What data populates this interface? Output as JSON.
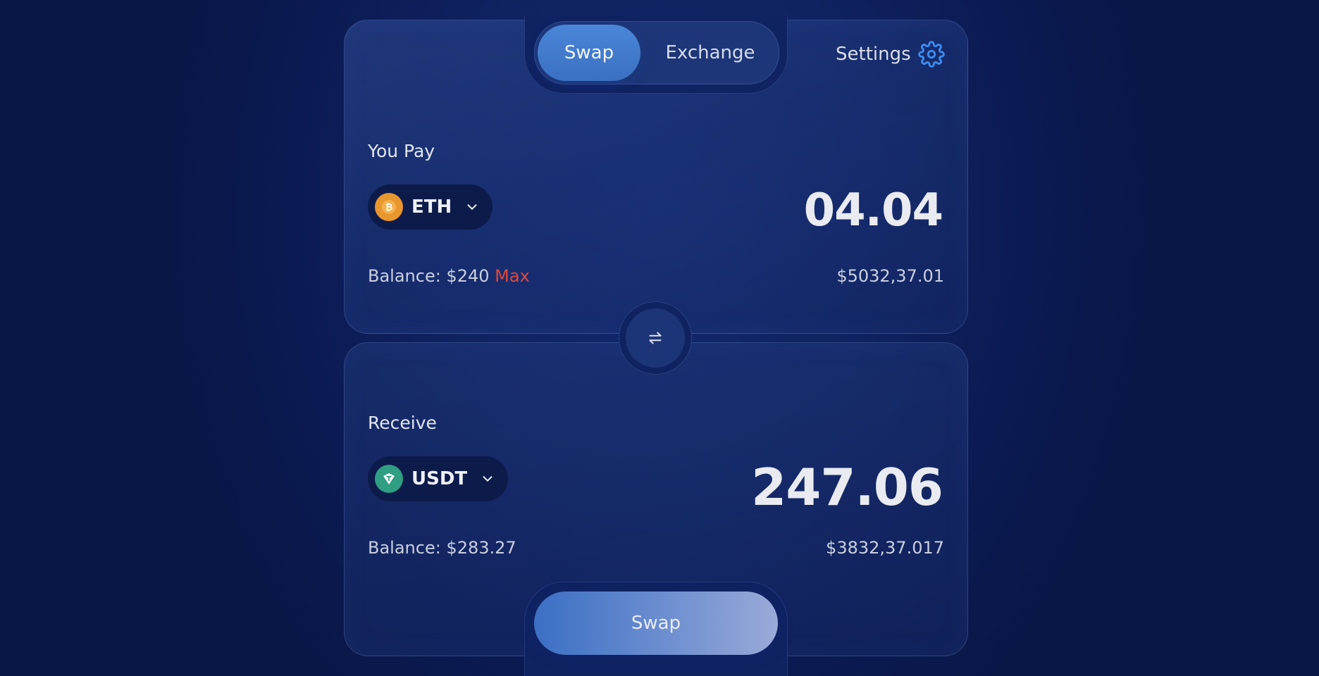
{
  "tabs": {
    "swap_label": "Swap",
    "exchange_label": "Exchange"
  },
  "settings": {
    "label": "Settings",
    "icon": "gear-icon"
  },
  "pay": {
    "label": "You Pay",
    "token": "ETH",
    "token_icon": "bitcoin-icon",
    "token_icon_color": "#e8962e",
    "amount": "04.04",
    "balance": "Balance: $240",
    "max_label": "Max",
    "usd_value": "$5032,37.01"
  },
  "receive": {
    "label": "Receive",
    "token": "USDT",
    "token_icon": "tether-icon",
    "token_icon_color": "#2f9e83",
    "amount": "247.06",
    "balance": "Balance: $283.27",
    "usd_value": "$3832,37.017"
  },
  "swap_button": {
    "label": "Swap"
  },
  "colors": {
    "accent": "#4a86d8",
    "max": "#e0483f",
    "background": "#0f2261"
  }
}
